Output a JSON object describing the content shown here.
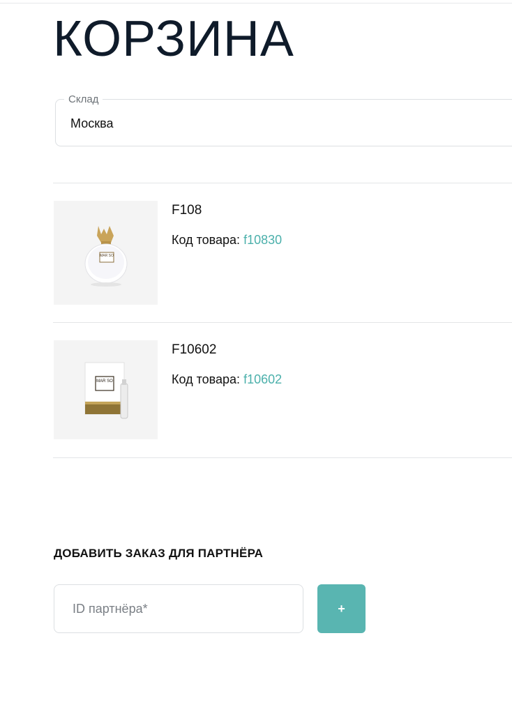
{
  "page": {
    "title": "КОРЗИНА"
  },
  "warehouse": {
    "label": "Склад",
    "value": "Москва"
  },
  "cart": {
    "code_label": "Код товара:",
    "items": [
      {
        "name": "F108",
        "code": "f10830",
        "image_icon": "perfume-bottle-icon",
        "brand_mark": "MAR SO"
      },
      {
        "name": "F10602",
        "code": "f10602",
        "image_icon": "perfume-sample-card-icon",
        "brand_mark": "MAR SO"
      }
    ]
  },
  "partner": {
    "heading": "ДОБАВИТЬ ЗАКАЗ ДЛЯ ПАРТНЁРА",
    "input_placeholder": "ID партнёра*",
    "input_value": "",
    "add_button_label": "+"
  },
  "colors": {
    "accent": "#4bb0ab",
    "button": "#59b5b1",
    "title": "#0f1b2a"
  }
}
